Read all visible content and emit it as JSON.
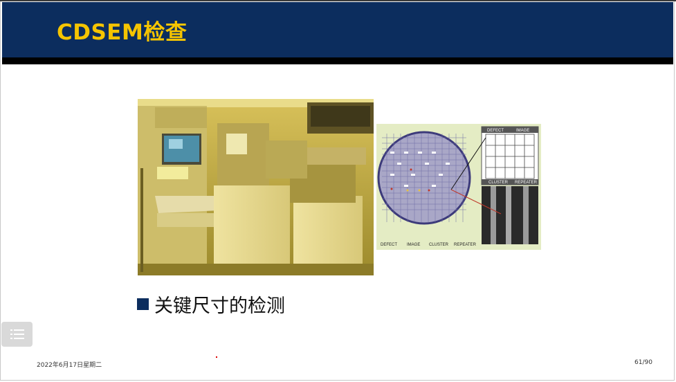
{
  "slide": {
    "title": "CDSEM检查",
    "bullet": "关键尺寸的检测",
    "date": "2022年6月17日星期二",
    "page_number": "61/90"
  },
  "wafer_panel": {
    "legend_top": [
      "DEFECT",
      "IMAGE"
    ],
    "legend_mid": [
      "CLUSTER",
      "REPEATER"
    ],
    "legend_bottom": [
      "DEFECT",
      "IMAGE",
      "CLUSTER",
      "REPEATER"
    ]
  },
  "icons": {
    "menu": "list-menu-icon",
    "bullet": "square-bullet-icon"
  },
  "colors": {
    "header_bg": "#0c2d5e",
    "title": "#f5c400",
    "bullet_square": "#0c2d5e"
  }
}
